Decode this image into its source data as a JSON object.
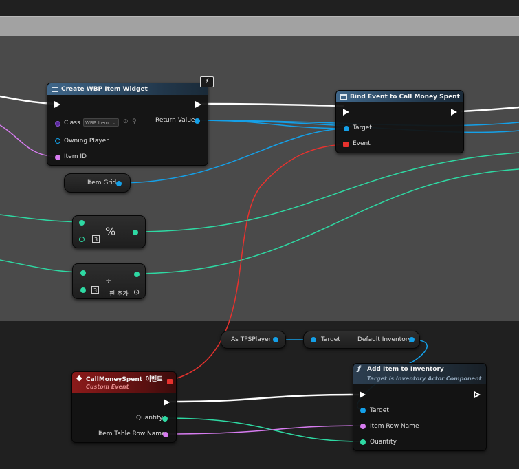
{
  "nodes": {
    "create_widget": {
      "title": "Create WBP Item Widget",
      "class_label": "Class",
      "class_value": "WBP Item",
      "owning_player": "Owning Player",
      "item_id": "Item ID",
      "return_value": "Return Value"
    },
    "bind_event": {
      "title": "Bind Event to Call Money Spent",
      "target": "Target",
      "event": "Event"
    },
    "item_grid": {
      "label": "Item Grid"
    },
    "modulo": {
      "op": "%",
      "value": "3"
    },
    "divide": {
      "op": "÷",
      "value": "3",
      "add_pin": "핀 추가"
    },
    "as_tps_player": {
      "label": "As TPSPlayer"
    },
    "default_inventory": {
      "target": "Target",
      "output": "Default Inventory"
    },
    "custom_event": {
      "title": "CallMoneySpent_이벤트",
      "subtitle": "Custom Event",
      "quantity": "Quantity",
      "row_name": "Item Table Row Name"
    },
    "add_item": {
      "title": "Add Item to Inventory",
      "subtitle": "Target is Inventory Actor Component",
      "target": "Target",
      "row_name": "Item Row Name",
      "quantity": "Quantity"
    }
  },
  "colors": {
    "exec": "#ffffff",
    "object": "#14a0e8",
    "integer": "#2ed9a3",
    "name": "#d77cf0",
    "delegate": "#e8322e"
  }
}
